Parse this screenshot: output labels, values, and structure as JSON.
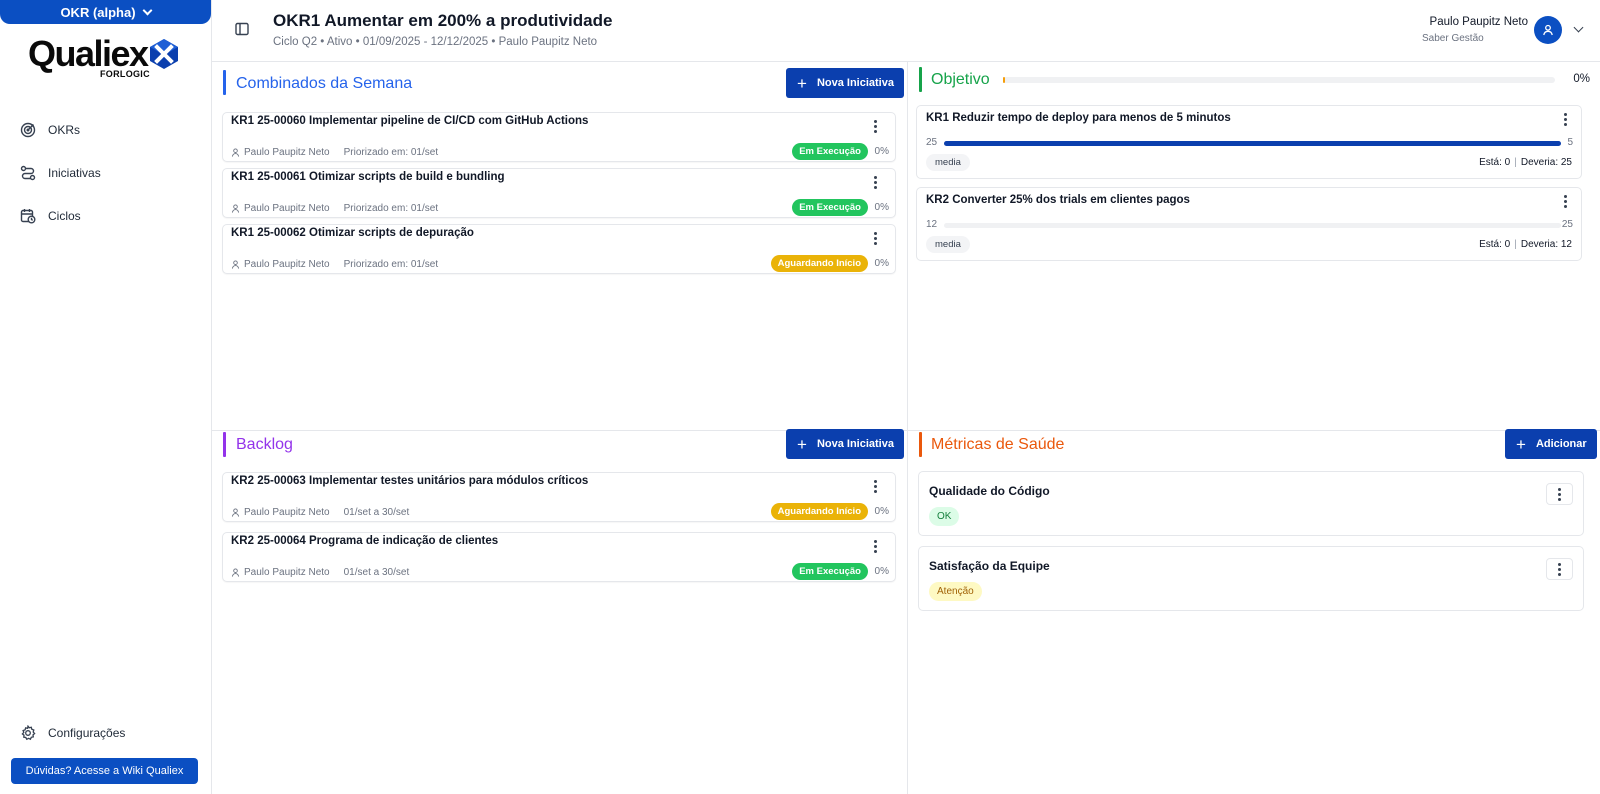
{
  "app_switch": {
    "label": "OKR (alpha)"
  },
  "logo": {
    "word": "Qualiex",
    "sub": "FORLOGIC"
  },
  "nav": [
    {
      "label": "OKRs",
      "icon": "target-icon"
    },
    {
      "label": "Iniciativas",
      "icon": "route-icon"
    },
    {
      "label": "Ciclos",
      "icon": "calendar-clock-icon"
    }
  ],
  "settings": {
    "label": "Configurações"
  },
  "wiki": {
    "label": "Dúvidas? Acesse a Wiki Qualiex"
  },
  "header": {
    "title": "OKR1 Aumentar em 200% a produtividade",
    "subtitle": "Ciclo Q2 • Ativo • 01/09/2025 - 12/12/2025 • Paulo Paupitz Neto",
    "user_name": "Paulo Paupitz Neto",
    "user_org": "Saber Gestão"
  },
  "combinados": {
    "title": "Combinados da Semana",
    "button": "Nova Iniciativa",
    "color": "#2563eb",
    "items": [
      {
        "title": "KR1 25-00060 Implementar pipeline de CI/CD com GitHub Actions",
        "owner": "Paulo Paupitz Neto",
        "date": "Priorizado em: 01/set",
        "status": "Em Execução",
        "status_color": "green",
        "progress": "0%"
      },
      {
        "title": "KR1 25-00061 Otimizar scripts de build e bundling",
        "owner": "Paulo Paupitz Neto",
        "date": "Priorizado em: 01/set",
        "status": "Em Execução",
        "status_color": "green",
        "progress": "0%"
      },
      {
        "title": "KR1 25-00062 Otimizar scripts de depuração",
        "owner": "Paulo Paupitz Neto",
        "date": "Priorizado em: 01/set",
        "status": "Aguardando Início",
        "status_color": "amber",
        "progress": "0%"
      }
    ]
  },
  "objetivo": {
    "title": "Objetivo",
    "progress_label": "0%",
    "progress_value": 0,
    "color": "#16a34a",
    "krs": [
      {
        "title": "KR1 Reduzir tempo de deploy para menos de 5 minutos",
        "start": "25",
        "target": "5",
        "fill": 1.0,
        "tag": "media",
        "esta": "Está: 0",
        "deveria": "Deveria: 25"
      },
      {
        "title": "KR2 Converter 25% dos trials em clientes pagos",
        "start": "12",
        "target": "25",
        "fill": 0.0,
        "tag": "media",
        "esta": "Está: 0",
        "deveria": "Deveria: 12"
      }
    ]
  },
  "backlog": {
    "title": "Backlog",
    "button": "Nova Iniciativa",
    "color": "#9333ea",
    "items": [
      {
        "title": "KR2 25-00063 Implementar testes unitários para módulos críticos",
        "owner": "Paulo Paupitz Neto",
        "date": "01/set a 30/set",
        "status": "Aguardando Início",
        "status_color": "amber",
        "progress": "0%"
      },
      {
        "title": "KR2 25-00064 Programa de indicação de clientes",
        "owner": "Paulo Paupitz Neto",
        "date": "01/set a 30/set",
        "status": "Em Execução",
        "status_color": "green",
        "progress": "0%"
      }
    ]
  },
  "metricas": {
    "title": "Métricas de Saúde",
    "button": "Adicionar",
    "color": "#ea580c",
    "items": [
      {
        "title": "Qualidade do Código",
        "status": "OK",
        "bg": "#dcfce7",
        "fg": "#15803d"
      },
      {
        "title": "Satisfação da Equipe",
        "status": "Atenção",
        "bg": "#fef9c3",
        "fg": "#a16207"
      }
    ]
  }
}
